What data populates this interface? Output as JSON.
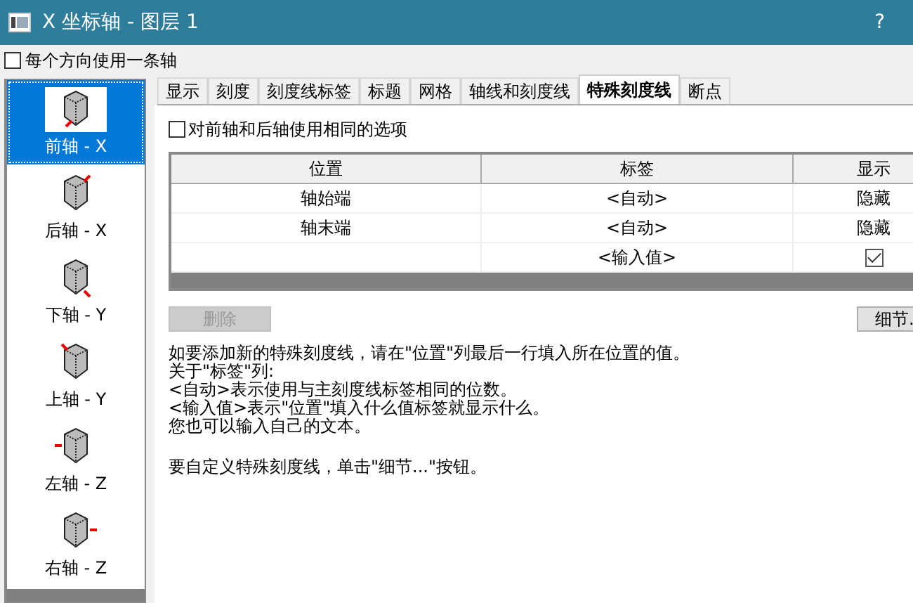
{
  "window": {
    "title": "X 坐标轴 - 图层 1",
    "help": "?"
  },
  "one_axis_each_direction": {
    "label": "每个方向使用一条轴",
    "checked": false
  },
  "axes": [
    {
      "label": "前轴 - X",
      "selected": true
    },
    {
      "label": "后轴 - X",
      "selected": false
    },
    {
      "label": "下轴 - Y",
      "selected": false
    },
    {
      "label": "上轴 - Y",
      "selected": false
    },
    {
      "label": "左轴 - Z",
      "selected": false
    },
    {
      "label": "右轴 - Z",
      "selected": false
    }
  ],
  "tabs": [
    {
      "label": "显示",
      "selected": false
    },
    {
      "label": "刻度",
      "selected": false
    },
    {
      "label": "刻度线标签",
      "selected": false
    },
    {
      "label": "标题",
      "selected": false
    },
    {
      "label": "网格",
      "selected": false
    },
    {
      "label": "轴线和刻度线",
      "selected": false
    },
    {
      "label": "特殊刻度线",
      "selected": true
    },
    {
      "label": "断点",
      "selected": false
    }
  ],
  "same_options": {
    "label": "对前轴和后轴使用相同的选项",
    "checked": false
  },
  "table": {
    "columns": [
      "位置",
      "标签",
      "显示"
    ],
    "rows": [
      {
        "position": "轴始端",
        "label": "<自动>",
        "display": {
          "kind": "text",
          "text": "隐藏"
        }
      },
      {
        "position": "轴末端",
        "label": "<自动>",
        "display": {
          "kind": "text",
          "text": "隐藏"
        }
      },
      {
        "position": "",
        "label": "<输入值>",
        "display": {
          "kind": "checkbox",
          "checked": true
        }
      }
    ]
  },
  "delete_button": {
    "label": "删除",
    "disabled": true
  },
  "details_button": {
    "label": "细节."
  },
  "help_lines": [
    "如要添加新的特殊刻度线，请在\"位置\"列最后一行填入所在位置的值。",
    "关于\"标签\"列:",
    "<自动>表示使用与主刻度线标签相同的位数。",
    "<输入值>表示\"位置\"填入什么值标签就显示什么。",
    "您也可以输入自己的文本。"
  ],
  "customize_hint": "要自定义特殊刻度线，单击\"细节...\"按钮。"
}
